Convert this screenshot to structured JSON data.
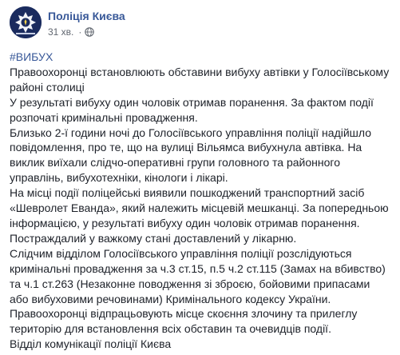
{
  "post": {
    "author": "Поліція Києва",
    "time": "31 хв.",
    "separator": "·",
    "privacy_icon": "globe-icon",
    "hashtag": "#ВИБУХ",
    "lines": [
      "Правоохоронці встановлюють обставини вибуху автівки у Голосіївському",
      "районі столиці",
      "У результаті вибуху один чоловік отримав поранення. За фактом події",
      "розпочаті кримінальні провадження.",
      "Близько 2-ї години ночі до Голосіївського управління поліції надійшло",
      "повідомлення, про те, що на вулиці Вільямса вибухнула автівка. На",
      "виклик виїхали слідчо-оперативні групи головного та районного",
      "управлінь, вибухотехніки, кінологи і лікарі.",
      "На місці події поліцейські виявили пошкоджений транспортний засіб",
      "«Шевролет Еванда», який належить місцевій мешканці. За попередньою",
      "інформацією, у результаті вибуху один чоловік отримав поранення.",
      "Постраждалий у важкому стані доставлений у лікарню.",
      "Слідчим відділом Голосіївського управління поліції розслідуються",
      "кримінальні провадження за ч.3 ст.15, п.5 ч.2 ст.115 (Замах на вбивство)",
      "та ч.1 ст.263 (Незаконне поводження зі зброєю, бойовими припасами",
      "або вибуховими речовинами) Кримінального кодексу України.",
      "Правоохоронці відпрацьовують місце скоєння злочину та прилеглу",
      "територію для встановлення всіх обставин та очевидців події.",
      "Відділ комунікації поліції Києва"
    ]
  },
  "colors": {
    "link": "#385898",
    "text": "#1d2129",
    "meta": "#616770",
    "avatar_bg": "#1a2b5e"
  }
}
